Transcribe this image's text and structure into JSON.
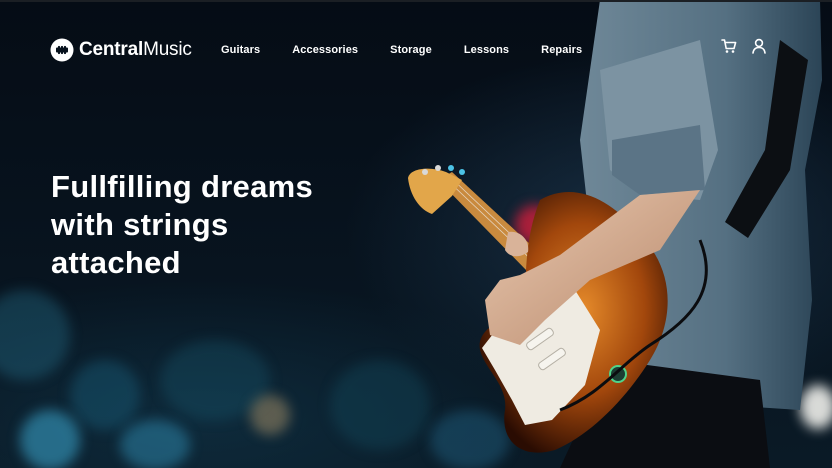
{
  "brand": {
    "name_bold": "Central",
    "name_light": "Music",
    "logo_icon": "guitar-pick-logo-icon"
  },
  "nav": {
    "items": [
      {
        "label": "Guitars"
      },
      {
        "label": "Accessories"
      },
      {
        "label": "Storage"
      },
      {
        "label": "Lessons"
      },
      {
        "label": "Repairs"
      }
    ]
  },
  "header_icons": {
    "cart_icon": "cart-icon",
    "user_icon": "user-icon"
  },
  "hero": {
    "headline_lines": [
      "Fullfilling dreams",
      "with strings",
      "attached"
    ],
    "image": "guitarist-on-stage-photo"
  },
  "colors": {
    "background": "#06111c",
    "text": "#ffffff",
    "shirt": "#5f7a8c",
    "guitar_body": "#b35a12",
    "pickguard": "#f0ece2"
  }
}
